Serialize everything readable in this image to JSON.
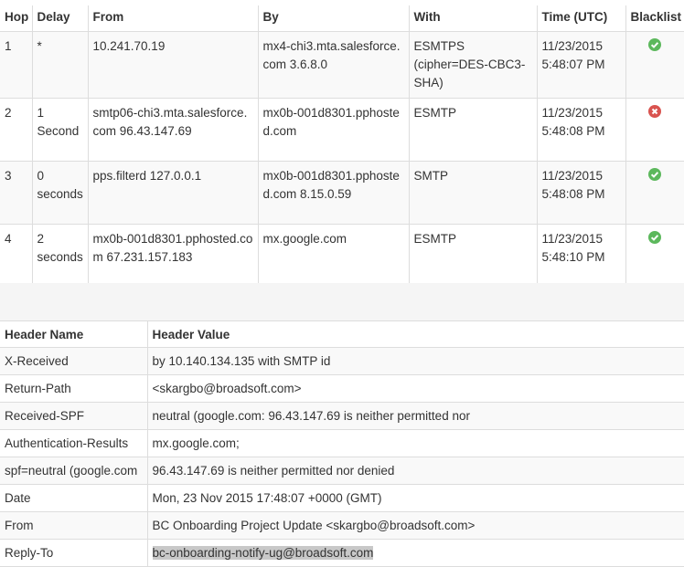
{
  "hops_table": {
    "headers": {
      "hop": "Hop",
      "delay": "Delay",
      "from": "From",
      "by": "By",
      "with": "With",
      "time": "Time (UTC)",
      "blacklist": "Blacklist"
    },
    "rows": [
      {
        "hop": "1",
        "delay": "*",
        "from": "10.241.70.19",
        "by": "mx4-chi3.mta.salesforce.com 3.6.8.0",
        "with": "ESMTPS (cipher=DES-CBC3-SHA)",
        "time": "11/23/2015 5:48:07 PM",
        "blacklist_icon": "check-circle-icon",
        "blacklist_status": "ok"
      },
      {
        "hop": "2",
        "delay": "1 Second",
        "from": "smtp06-chi3.mta.salesforce.com 96.43.147.69",
        "by": "mx0b-001d8301.pphosted.com",
        "with": "ESMTP",
        "time": "11/23/2015 5:48:08 PM",
        "blacklist_icon": "x-circle-icon",
        "blacklist_status": "listed"
      },
      {
        "hop": "3",
        "delay": "0 seconds",
        "from": "pps.filterd 127.0.0.1",
        "by": "mx0b-001d8301.pphosted.com 8.15.0.59",
        "with": "SMTP",
        "time": "11/23/2015 5:48:08 PM",
        "blacklist_icon": "check-circle-icon",
        "blacklist_status": "ok"
      },
      {
        "hop": "4",
        "delay": "2 seconds",
        "from": "mx0b-001d8301.pphosted.com 67.231.157.183",
        "by": "mx.google.com",
        "with": "ESMTP",
        "time": "11/23/2015 5:48:10 PM",
        "blacklist_icon": "check-circle-icon",
        "blacklist_status": "ok"
      }
    ]
  },
  "headers_table": {
    "headers": {
      "name": "Header Name",
      "value": "Header Value"
    },
    "rows": [
      {
        "name": "X-Received",
        "value": "by 10.140.134.135 with SMTP id"
      },
      {
        "name": "Return-Path",
        "value": "<skargbo@broadsoft.com>"
      },
      {
        "name": "Received-SPF",
        "value": "neutral (google.com: 96.43.147.69 is neither permitted nor"
      },
      {
        "name": "Authentication-Results",
        "value": "mx.google.com;"
      },
      {
        "name": "spf=neutral (google.com",
        "value": "96.43.147.69 is neither permitted nor denied"
      },
      {
        "name": "Date",
        "value": "Mon, 23 Nov 2015 17:48:07 +0000 (GMT)"
      },
      {
        "name": "From",
        "value": "BC Onboarding Project Update <skargbo@broadsoft.com>"
      },
      {
        "name": "Reply-To",
        "value": "bc-onboarding-notify-ug@broadsoft.com"
      }
    ]
  },
  "colors": {
    "ok": "#5cb85c",
    "listed": "#d9534f",
    "selection": "#c8c8c8"
  }
}
